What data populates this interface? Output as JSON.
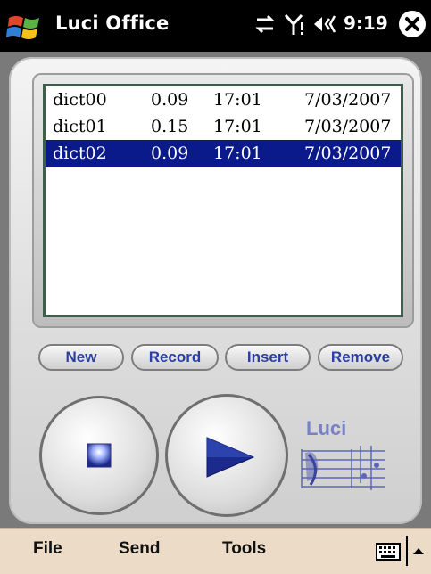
{
  "status_bar": {
    "app_title": "Luci Office",
    "time": "9:19"
  },
  "recordings": [
    {
      "name": "dict00",
      "length": "0.09",
      "time": "17:01",
      "date": "7/03/2007",
      "selected": false
    },
    {
      "name": "dict01",
      "length": "0.15",
      "time": "17:01",
      "date": "7/03/2007",
      "selected": false
    },
    {
      "name": "dict02",
      "length": "0.09",
      "time": "17:01",
      "date": "7/03/2007",
      "selected": true
    }
  ],
  "buttons": {
    "new": "New",
    "record": "Record",
    "insert": "Insert",
    "remove": "Remove"
  },
  "logo": {
    "text": "Luci"
  },
  "menu": {
    "file": "File",
    "send": "Send",
    "tools": "Tools"
  },
  "icons": [
    "windows-start-icon",
    "connectivity-icon",
    "signal-icon",
    "volume-icon",
    "close-icon",
    "stop-icon",
    "play-icon",
    "music-staff-icon",
    "keyboard-icon",
    "arrow-up-icon"
  ],
  "colors": {
    "selection": "#0a1a8a",
    "button_text": "#2b3fa0",
    "menu_bar": "#ecdcc7"
  }
}
